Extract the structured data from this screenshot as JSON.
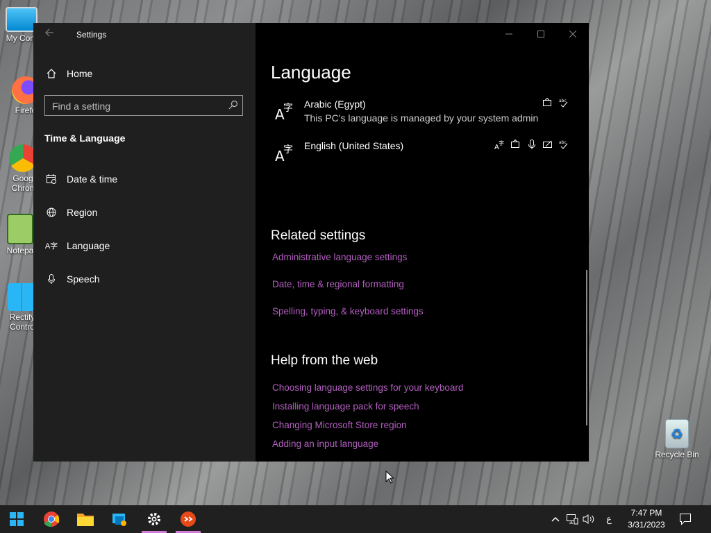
{
  "desktop": {
    "icons": [
      {
        "label": "My Com"
      },
      {
        "label": "Firefo"
      },
      {
        "label": "Goog Chron"
      },
      {
        "label": "Notepa"
      },
      {
        "label": "Rectify Contro"
      },
      {
        "label": "Recycle Bin"
      }
    ]
  },
  "window": {
    "title": "Settings",
    "sidebar": {
      "home": "Home",
      "search_placeholder": "Find a setting",
      "section": "Time & Language",
      "items": [
        {
          "label": "Date & time",
          "icon": "calendar-icon"
        },
        {
          "label": "Region",
          "icon": "globe-icon"
        },
        {
          "label": "Language",
          "icon": "language-icon"
        },
        {
          "label": "Speech",
          "icon": "microphone-icon"
        }
      ]
    },
    "main": {
      "title": "Language",
      "languages": [
        {
          "name": "Arabic (Egypt)",
          "note": "This PC's language is managed by your system admin",
          "features": [
            "display-feature-icon",
            "spelling-feature-icon"
          ]
        },
        {
          "name": "English (United States)",
          "note": "",
          "features": [
            "language-pack-icon",
            "display-feature-icon",
            "speech-feature-icon",
            "handwriting-feature-icon",
            "spelling-feature-icon"
          ]
        }
      ],
      "related": {
        "title": "Related settings",
        "links": [
          "Administrative language settings",
          "Date, time & regional formatting",
          "Spelling, typing, & keyboard settings"
        ]
      },
      "help": {
        "title": "Help from the web",
        "links": [
          "Choosing language settings for your keyboard",
          "Installing language pack for speech",
          "Changing Microsoft Store region",
          "Adding an input language"
        ]
      }
    }
  },
  "taskbar": {
    "apps": [
      "start-button",
      "chrome",
      "file-explorer",
      "control-panel",
      "settings",
      "remote-desktop"
    ],
    "input_indicator": "ع",
    "time": "7:47 PM",
    "date": "3/31/2023"
  },
  "colors": {
    "link": "#b35fc0",
    "accent_underline": "#d27bd6"
  }
}
